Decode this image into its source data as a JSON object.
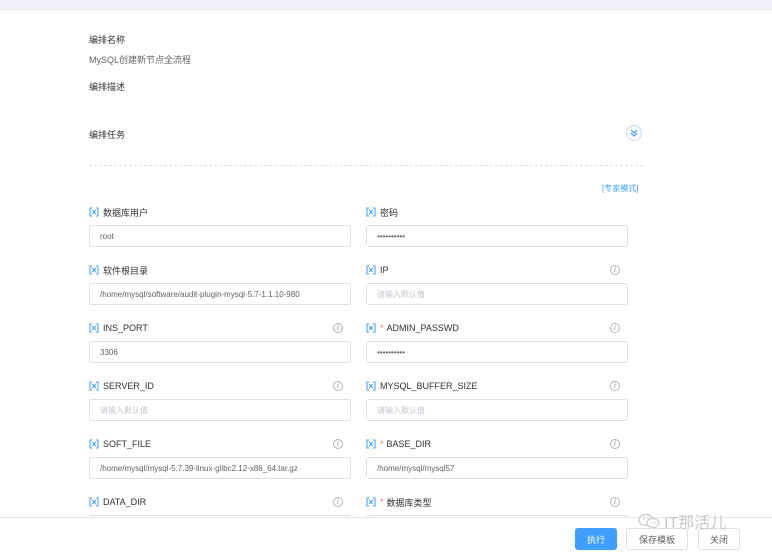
{
  "orchestration": {
    "name_label": "编排名称",
    "name_value": "MySQL创建新节点全流程",
    "desc_label": "编排描述",
    "task_label": "编排任务",
    "expert_mode": "[专家模式]"
  },
  "fields": [
    {
      "label": "数据库用户",
      "required": false,
      "info": false,
      "value": "root",
      "placeholder": ""
    },
    {
      "label": "密码",
      "required": false,
      "info": false,
      "value": "••••••••••",
      "placeholder": ""
    },
    {
      "label": "软件根目录",
      "required": false,
      "info": false,
      "value": "/home/mysql/software/audit-plugin-mysql-5.7-1.1.10-980",
      "placeholder": ""
    },
    {
      "label": "IP",
      "required": false,
      "info": true,
      "value": "",
      "placeholder": "请输入默认值"
    },
    {
      "label": "INS_PORT",
      "required": false,
      "info": true,
      "value": "3306",
      "placeholder": ""
    },
    {
      "label": "ADMIN_PASSWD",
      "required": true,
      "info": true,
      "value": "••••••••••",
      "placeholder": ""
    },
    {
      "label": "SERVER_ID",
      "required": false,
      "info": true,
      "value": "",
      "placeholder": "请输入默认值"
    },
    {
      "label": "MYSQL_BUFFER_SIZE",
      "required": false,
      "info": true,
      "value": "",
      "placeholder": "请输入默认值"
    },
    {
      "label": "SOFT_FILE",
      "required": false,
      "info": true,
      "value": "/home/mysql/mysql-5.7.39-linux-glibc2.12-x86_64.tar.gz",
      "placeholder": ""
    },
    {
      "label": "BASE_DIR",
      "required": true,
      "info": true,
      "value": "/home/mysql/mysql57",
      "placeholder": ""
    },
    {
      "label": "DATA_DIR",
      "required": false,
      "info": true,
      "value": "",
      "placeholder": ""
    },
    {
      "label": "数据库类型",
      "required": true,
      "info": true,
      "value": "",
      "placeholder": ""
    }
  ],
  "footer": {
    "execute": "执行",
    "save_template": "保存模板",
    "close": "关闭"
  },
  "watermark": "IT那活儿",
  "colors": {
    "primary": "#409eff",
    "required": "#f56c6c",
    "border": "#dcdfe6"
  }
}
